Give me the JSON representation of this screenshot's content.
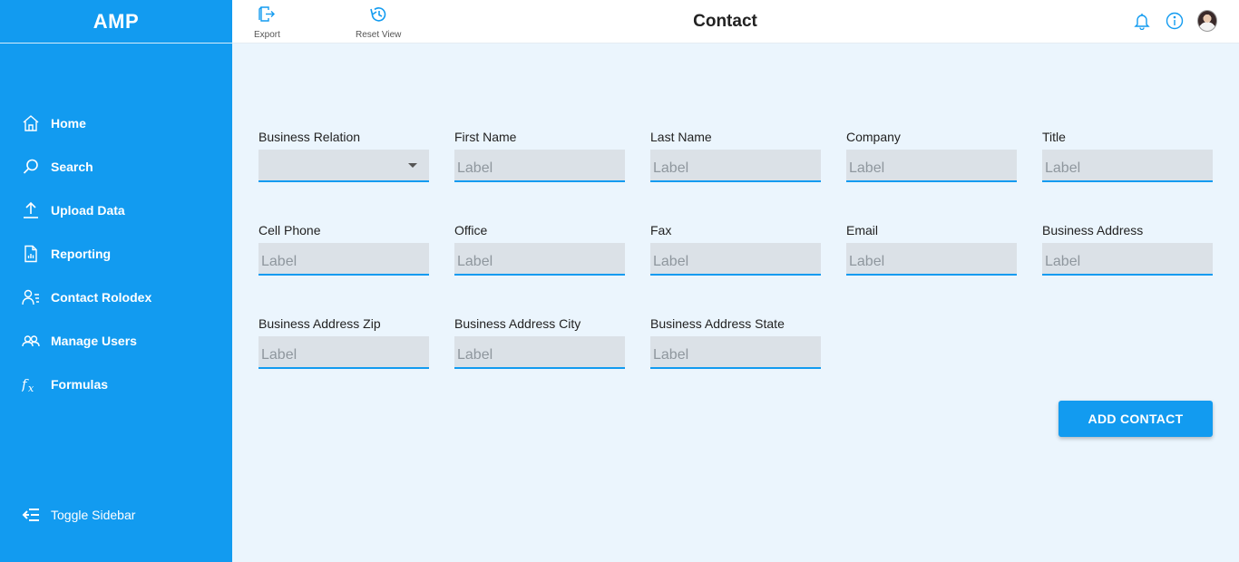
{
  "app": {
    "brand": "AMP",
    "page_title": "Contact"
  },
  "toolbar": {
    "export_label": "Export",
    "reset_label": "Reset View"
  },
  "colors": {
    "accent": "#129bf0",
    "background": "#ebf5fd",
    "input_bg": "#dbe1e7"
  },
  "sidebar": {
    "items": [
      {
        "label": "Home",
        "icon": "home-icon"
      },
      {
        "label": "Search",
        "icon": "search-icon"
      },
      {
        "label": "Upload Data",
        "icon": "upload-icon"
      },
      {
        "label": "Reporting",
        "icon": "report-icon"
      },
      {
        "label": "Contact Rolodex",
        "icon": "contact-list-icon"
      },
      {
        "label": "Manage Users",
        "icon": "users-icon"
      },
      {
        "label": "Formulas",
        "icon": "function-icon"
      }
    ],
    "toggle_label": "Toggle Sidebar"
  },
  "form": {
    "fields": [
      {
        "label": "Business Relation",
        "placeholder": "",
        "type": "select"
      },
      {
        "label": "First Name",
        "placeholder": "Label"
      },
      {
        "label": "Last Name",
        "placeholder": "Label"
      },
      {
        "label": "Company",
        "placeholder": "Label"
      },
      {
        "label": "Title",
        "placeholder": "Label"
      },
      {
        "label": "Cell Phone",
        "placeholder": "Label"
      },
      {
        "label": "Office",
        "placeholder": "Label"
      },
      {
        "label": "Fax",
        "placeholder": "Label"
      },
      {
        "label": "Email",
        "placeholder": "Label"
      },
      {
        "label": "Business Address",
        "placeholder": "Label"
      },
      {
        "label": "Business Address Zip",
        "placeholder": "Label"
      },
      {
        "label": "Business Address City",
        "placeholder": "Label"
      },
      {
        "label": "Business Address State",
        "placeholder": "Label"
      }
    ],
    "submit_label": "ADD CONTACT"
  }
}
